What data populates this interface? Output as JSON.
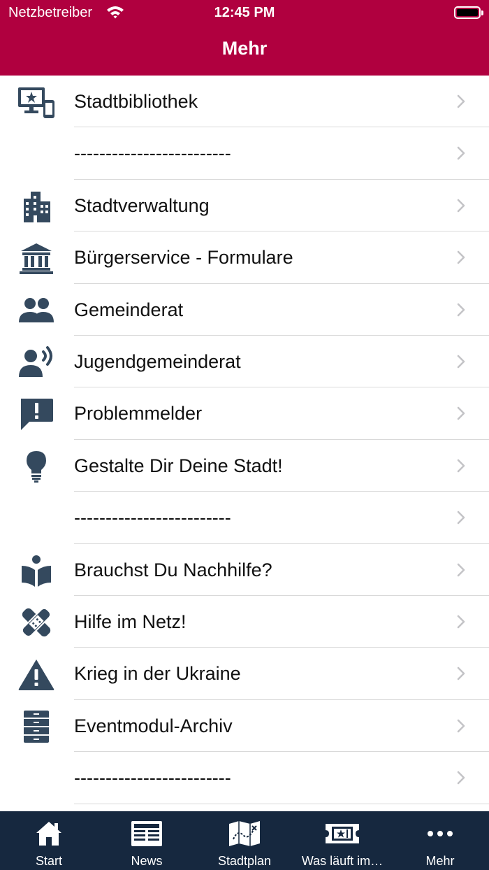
{
  "status_bar": {
    "carrier": "Netzbetreiber",
    "time": "12:45 PM"
  },
  "header": {
    "title": "Mehr"
  },
  "menu": {
    "items": [
      {
        "label": "Stadtbibliothek",
        "icon": "library-devices-icon"
      },
      {
        "label": "-------------------------",
        "icon": ""
      },
      {
        "label": "Stadtverwaltung",
        "icon": "city-building-icon"
      },
      {
        "label": "Bürgerservice - Formulare",
        "icon": "bank-institution-icon"
      },
      {
        "label": "Gemeinderat",
        "icon": "users-icon"
      },
      {
        "label": "Jugendgemeinderat",
        "icon": "speaking-person-icon"
      },
      {
        "label": "Problemmelder",
        "icon": "alert-comment-icon"
      },
      {
        "label": "Gestalte Dir Deine Stadt!",
        "icon": "lightbulb-icon"
      },
      {
        "label": "-------------------------",
        "icon": ""
      },
      {
        "label": "Brauchst Du Nachhilfe?",
        "icon": "reader-book-icon"
      },
      {
        "label": "Hilfe im Netz!",
        "icon": "band-aid-icon"
      },
      {
        "label": "Krieg in der Ukraine",
        "icon": "warning-triangle-icon"
      },
      {
        "label": "Eventmodul-Archiv",
        "icon": "archive-cabinet-icon"
      },
      {
        "label": "-------------------------",
        "icon": ""
      },
      {
        "label": "",
        "icon": ""
      }
    ]
  },
  "tabbar": {
    "tabs": [
      {
        "label": "Start",
        "icon": "home-icon"
      },
      {
        "label": "News",
        "icon": "newspaper-icon"
      },
      {
        "label": "Stadtplan",
        "icon": "map-icon"
      },
      {
        "label": "Was läuft im…",
        "icon": "ticket-icon"
      },
      {
        "label": "Mehr",
        "icon": "more-dots-icon"
      }
    ]
  },
  "colors": {
    "header": "#b0003f",
    "tabbar": "#16283f",
    "icon": "#34495e",
    "chevron": "#c4c4c7"
  }
}
